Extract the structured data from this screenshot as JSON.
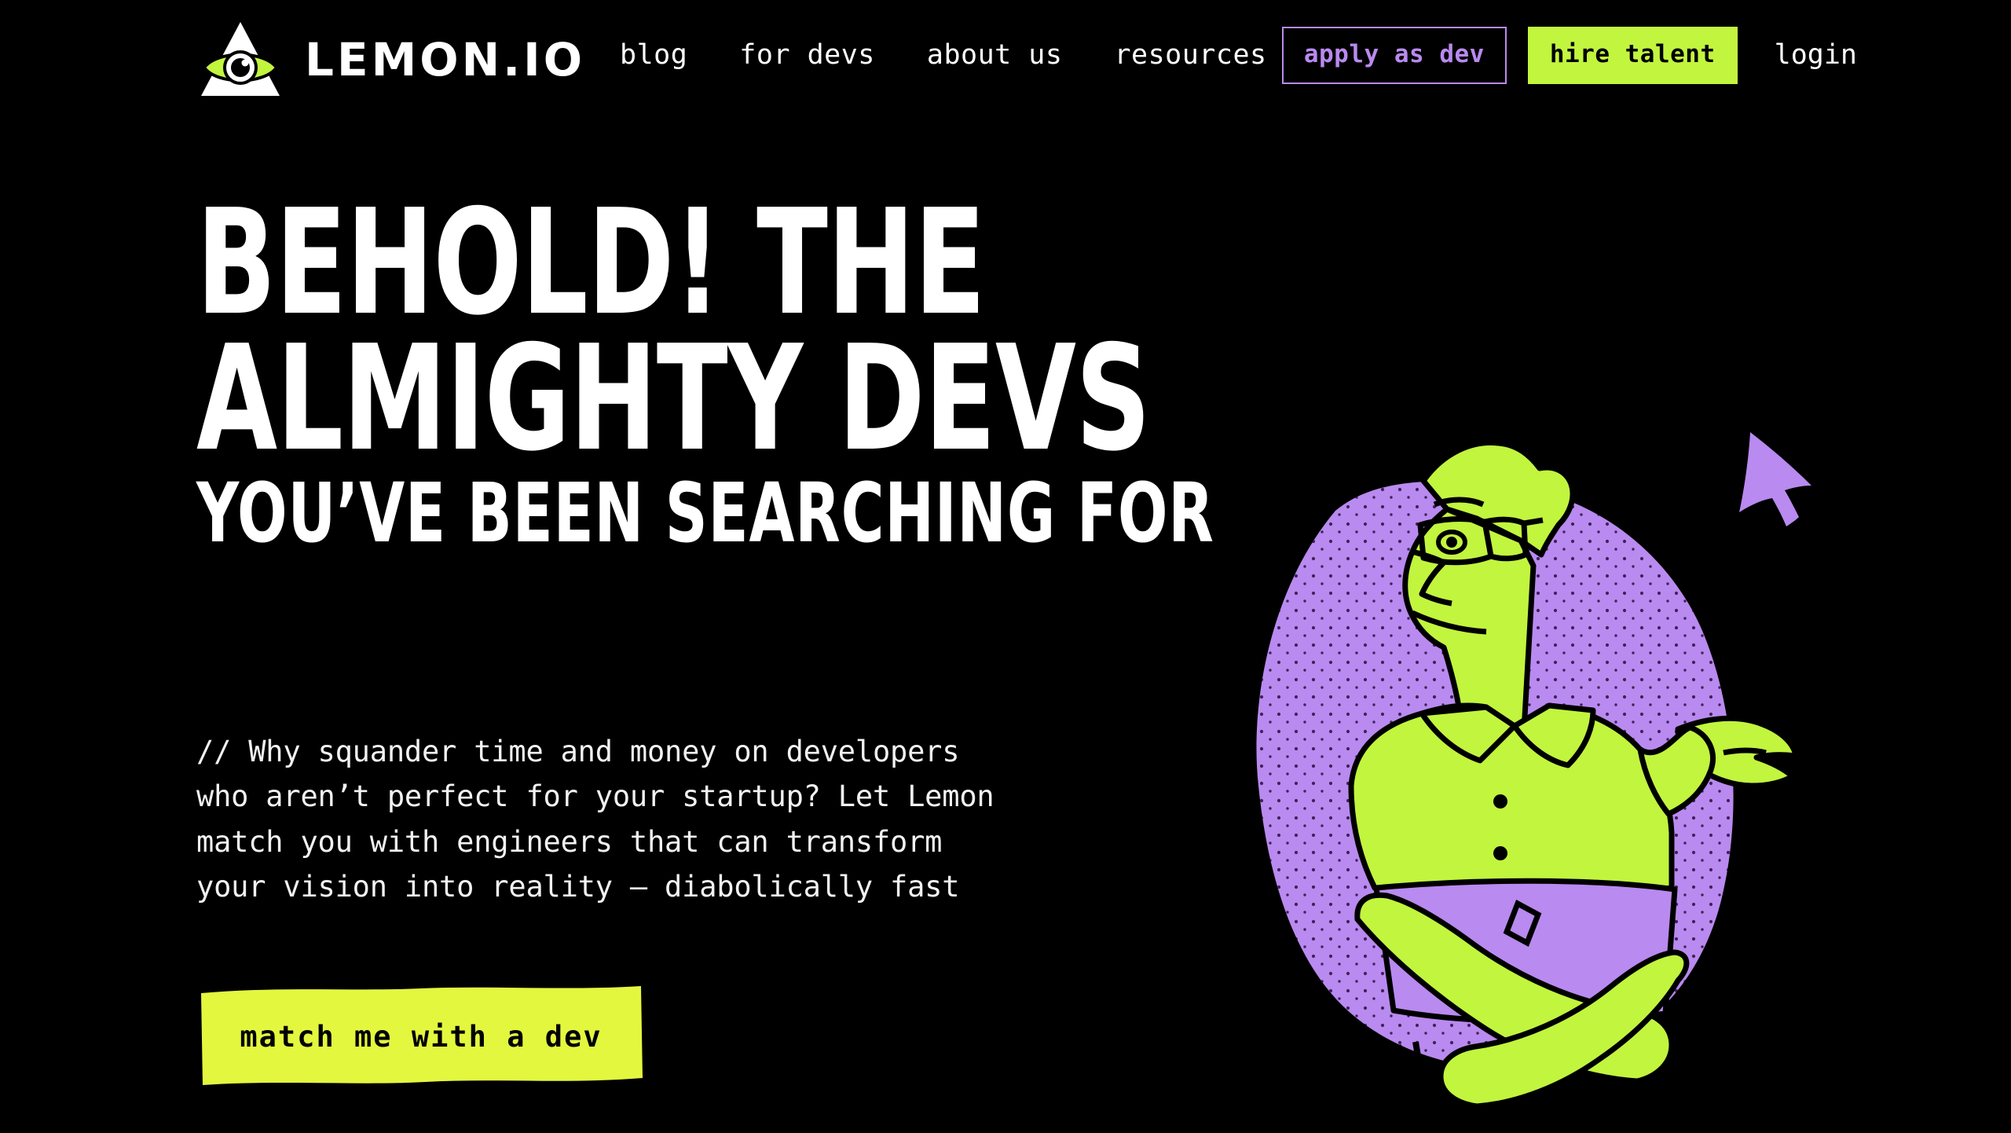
{
  "brand": {
    "name": "LEMON.IO",
    "logo_icon": "triangle-eye-icon",
    "accent_lime": "#c2f53e",
    "accent_purple": "#b98aef",
    "background": "#000000",
    "text": "#ffffff"
  },
  "nav": {
    "links": [
      {
        "label": "blog",
        "name": "nav-link-blog"
      },
      {
        "label": "for devs",
        "name": "nav-link-for-devs"
      },
      {
        "label": "about us",
        "name": "nav-link-about-us"
      },
      {
        "label": "resources",
        "name": "nav-link-resources"
      }
    ],
    "apply_as_dev": "apply as dev",
    "hire_talent": "hire talent",
    "login": "login"
  },
  "hero": {
    "headline_line1": "BEHOLD! THE",
    "headline_line2": "ALMIGHTY DEVS",
    "headline_line3": "YOU’VE BEEN SEARCHING FOR",
    "paragraph_lines": [
      "// Why squander time and money on developers",
      "who aren’t perfect for your startup? Let Lemon",
      "match you with engineers that can transform",
      "your vision into reality — diabolically fast"
    ],
    "cta_label": "match me with a dev",
    "illustration_name": "developer-with-laptop-illustration"
  }
}
